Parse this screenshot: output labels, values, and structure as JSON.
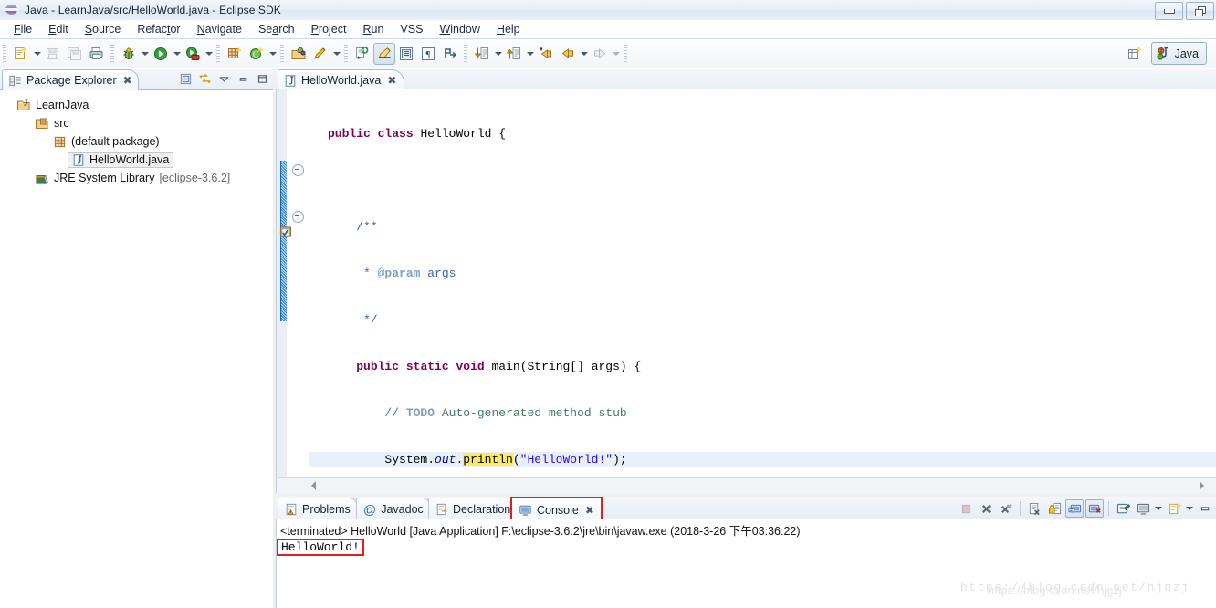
{
  "window": {
    "title": "Java - LearnJava/src/HelloWorld.java - Eclipse SDK",
    "icon": "eclipse-globe-icon",
    "buttons": [
      {
        "name": "minimize-button",
        "glyph": "minimize"
      },
      {
        "name": "restore-button",
        "glyph": "restore"
      }
    ]
  },
  "menubar": {
    "items": [
      {
        "label": "File",
        "mnemonic": "F"
      },
      {
        "label": "Edit",
        "mnemonic": "E"
      },
      {
        "label": "Source",
        "mnemonic": "S"
      },
      {
        "label": "Refactor",
        "mnemonic": "t"
      },
      {
        "label": "Navigate",
        "mnemonic": "N"
      },
      {
        "label": "Search",
        "mnemonic": "a"
      },
      {
        "label": "Project",
        "mnemonic": "P"
      },
      {
        "label": "Run",
        "mnemonic": "R"
      },
      {
        "label": "VSS",
        "mnemonic": ""
      },
      {
        "label": "Window",
        "mnemonic": "W"
      },
      {
        "label": "Help",
        "mnemonic": "H"
      }
    ]
  },
  "toolbar": {
    "buttons": [
      {
        "name": "new-wizard-button",
        "icon": "new-file-icon",
        "has_dropdown": true
      },
      {
        "name": "save-button",
        "icon": "save-disk-icon",
        "has_dropdown": false,
        "enabled": false
      },
      {
        "name": "save-all-button",
        "icon": "save-all-icon",
        "has_dropdown": false,
        "enabled": false
      },
      {
        "name": "print-button",
        "icon": "printer-icon",
        "has_dropdown": false
      },
      {
        "name": "debug-button",
        "icon": "bug-icon",
        "has_dropdown": true
      },
      {
        "name": "run-button",
        "icon": "run-green-play-icon",
        "has_dropdown": true
      },
      {
        "name": "external-tools-button",
        "icon": "external-tools-icon",
        "has_dropdown": true
      },
      {
        "name": "new-java-package-button",
        "icon": "package-new-icon",
        "has_dropdown": false
      },
      {
        "name": "new-java-class-button",
        "icon": "class-new-icon",
        "has_dropdown": true
      },
      {
        "name": "open-type-button",
        "icon": "open-type-folder-icon",
        "has_dropdown": false
      },
      {
        "name": "search-button",
        "icon": "search-pencil-icon",
        "has_dropdown": true
      },
      {
        "name": "last-edit-location-button",
        "icon": "last-edit-location-icon",
        "has_dropdown": false
      },
      {
        "name": "toggle-mark-occurrences-button",
        "icon": "highlighter-pen-icon",
        "has_dropdown": false,
        "pressed": true
      },
      {
        "name": "show-whitespace-button",
        "icon": "whitespace-icon",
        "has_dropdown": false
      },
      {
        "name": "toggle-block-selection-button",
        "icon": "pilcrow-icon",
        "has_dropdown": false
      },
      {
        "name": "skip-all-breakpoints-button",
        "icon": "skip-breakpoints-icon",
        "has_dropdown": false
      },
      {
        "name": "next-annotation-button",
        "icon": "down-arrow-annotation-icon",
        "has_dropdown": true
      },
      {
        "name": "previous-annotation-button",
        "icon": "up-arrow-annotation-icon",
        "has_dropdown": true
      },
      {
        "name": "back-history-button",
        "icon": "back-arrow-star-icon",
        "has_dropdown": false
      },
      {
        "name": "back-button",
        "icon": "back-arrow-icon",
        "has_dropdown": true
      },
      {
        "name": "forward-button",
        "icon": "forward-arrow-icon",
        "has_dropdown": true,
        "enabled": false
      }
    ],
    "perspective": {
      "open_perspective_icon": "open-perspective-icon",
      "current_label": "Java",
      "current_icon": "java-perspective-icon"
    }
  },
  "package_explorer": {
    "tab_label": "Package Explorer",
    "tab_icon": "package-explorer-icon",
    "tab_close": "✖",
    "tools": [
      {
        "name": "collapse-all-button",
        "icon": "collapse-all-icon"
      },
      {
        "name": "link-with-editor-button",
        "icon": "link-editor-icon"
      },
      {
        "name": "view-menu-button",
        "icon": "chevron-down-icon"
      },
      {
        "name": "minimize-view-button",
        "icon": "minimize-view-icon"
      },
      {
        "name": "maximize-view-button",
        "icon": "maximize-view-icon"
      }
    ],
    "tree": [
      {
        "label": "LearnJava",
        "icon": "java-project-icon",
        "indent": 1,
        "selected": false,
        "suffix": ""
      },
      {
        "label": "src",
        "icon": "source-folder-icon",
        "indent": 2,
        "selected": false,
        "suffix": ""
      },
      {
        "label": "(default package)",
        "icon": "package-icon",
        "indent": 3,
        "selected": false,
        "suffix": ""
      },
      {
        "label": "HelloWorld.java",
        "icon": "java-file-icon",
        "indent": 4,
        "selected": true,
        "suffix": ""
      },
      {
        "label": "JRE System Library",
        "icon": "jre-library-icon",
        "indent": 2,
        "selected": false,
        "suffix": "[eclipse-3.6.2]"
      }
    ]
  },
  "editor": {
    "tab_label": "HelloWorld.java",
    "tab_icon": "java-file-icon",
    "tab_close": "✖",
    "code_lines": [
      {
        "indent": 0,
        "tokens": [
          {
            "t": "public",
            "c": "kw"
          },
          {
            "t": " ",
            "c": ""
          },
          {
            "t": "class",
            "c": "kw"
          },
          {
            "t": " HelloWorld {",
            "c": ""
          }
        ]
      },
      {
        "indent": 0,
        "tokens": []
      },
      {
        "indent": 1,
        "tokens": [
          {
            "t": "/**",
            "c": "jdoc"
          }
        ]
      },
      {
        "indent": 1,
        "tokens": [
          {
            "t": " * ",
            "c": "jdoc"
          },
          {
            "t": "@param",
            "c": "jdoc-tag"
          },
          {
            "t": " args",
            "c": "jdoc"
          }
        ]
      },
      {
        "indent": 1,
        "tokens": [
          {
            "t": " */",
            "c": "jdoc"
          }
        ]
      },
      {
        "indent": 1,
        "tokens": [
          {
            "t": "public",
            "c": "kw"
          },
          {
            "t": " ",
            "c": ""
          },
          {
            "t": "static",
            "c": "kw"
          },
          {
            "t": " ",
            "c": ""
          },
          {
            "t": "void",
            "c": "kw"
          },
          {
            "t": " main(String[] args) {",
            "c": ""
          }
        ]
      },
      {
        "indent": 2,
        "tokens": [
          {
            "t": "// ",
            "c": "cmt"
          },
          {
            "t": "TODO",
            "c": "todo"
          },
          {
            "t": " Auto-generated method stub",
            "c": "cmt"
          }
        ]
      },
      {
        "indent": 2,
        "current": true,
        "tokens": [
          {
            "t": "System.",
            "c": ""
          },
          {
            "t": "out",
            "c": "fld"
          },
          {
            "t": ".",
            "c": ""
          },
          {
            "t": "println",
            "c": "hl"
          },
          {
            "t": "(",
            "c": ""
          },
          {
            "t": "\"HelloWorld!\"",
            "c": "str"
          },
          {
            "t": ");",
            "c": ""
          }
        ]
      },
      {
        "indent": 1,
        "tokens": [
          {
            "t": "}",
            "c": ""
          }
        ]
      },
      {
        "indent": 0,
        "tokens": []
      },
      {
        "indent": 0,
        "tokens": [
          {
            "t": "}",
            "c": ""
          }
        ]
      }
    ],
    "folding_markers": [
      "collapse-javadoc-marker",
      "collapse-method-marker"
    ],
    "quickfix_icon": "quickfix-todo-icon",
    "change_bar_name": "changed-lines-ruler"
  },
  "console": {
    "tabs": [
      {
        "label": "Problems",
        "icon": "problems-icon",
        "active": false,
        "highlighted": false
      },
      {
        "label": "Javadoc",
        "icon": "javadoc-at-icon",
        "active": false,
        "highlighted": false
      },
      {
        "label": "Declaration",
        "icon": "declaration-icon",
        "active": false,
        "highlighted": false
      },
      {
        "label": "Console",
        "icon": "console-monitor-icon",
        "active": true,
        "highlighted": true,
        "close": "✖"
      }
    ],
    "tools": [
      {
        "name": "terminate-button",
        "icon": "terminate-stop-icon",
        "enabled": false
      },
      {
        "name": "remove-launch-button",
        "icon": "remove-x-icon"
      },
      {
        "name": "remove-all-terminated-button",
        "icon": "remove-all-x-icon"
      },
      {
        "name": "clear-console-button",
        "icon": "clear-console-icon"
      },
      {
        "name": "scroll-lock-button",
        "icon": "scroll-lock-icon"
      },
      {
        "name": "show-console-on-output-button",
        "icon": "show-console-out-icon",
        "pressed": true
      },
      {
        "name": "show-console-on-error-button",
        "icon": "show-console-err-icon",
        "pressed": true
      },
      {
        "name": "pin-console-button",
        "icon": "pin-console-icon"
      },
      {
        "name": "display-selected-console-button",
        "icon": "display-console-icon",
        "has_dropdown": true
      },
      {
        "name": "open-console-button",
        "icon": "open-console-new-icon",
        "has_dropdown": true
      },
      {
        "name": "minimize-console-button",
        "icon": "minimize-view-icon"
      }
    ],
    "header_line": "<terminated> HelloWorld [Java Application] F:\\eclipse-3.6.2\\jre\\bin\\javaw.exe (2018-3-26 下午03:36:22)",
    "output_line": "HelloWorld!"
  },
  "annotations": {
    "highlight_color": "#e02020",
    "boxes": [
      "console-tab-highlight",
      "console-output-highlight"
    ]
  },
  "watermark": {
    "text": "https://blog.csdn.net/hjgzj",
    "overlay_text": "https://blog.csdn.net/hjgzj"
  }
}
